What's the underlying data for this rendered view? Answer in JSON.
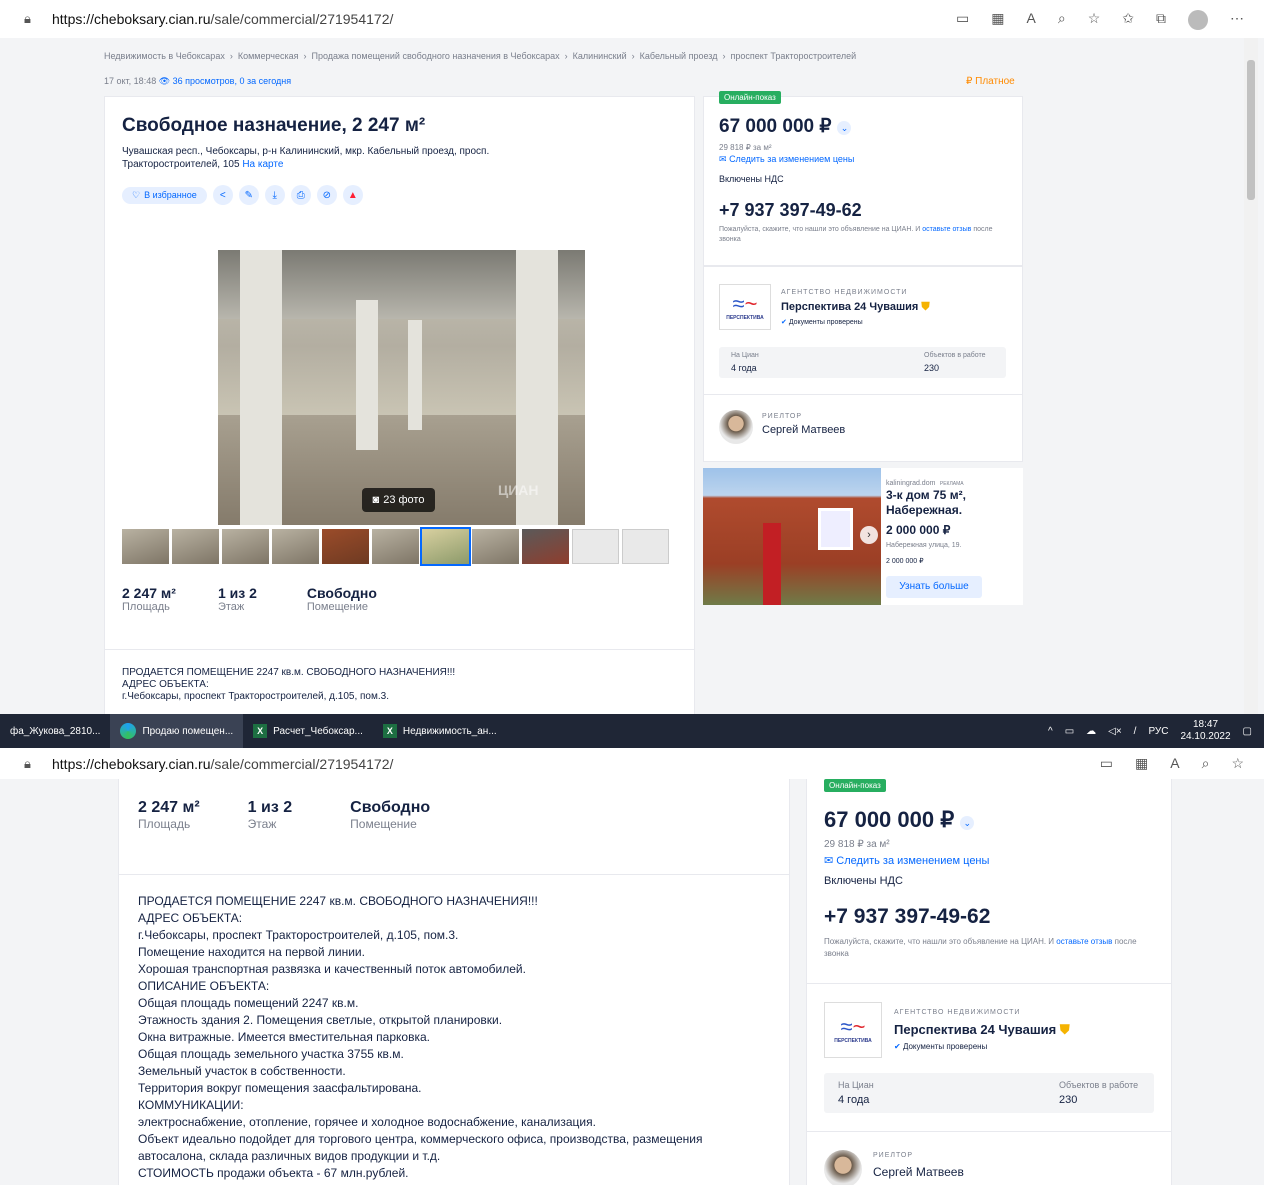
{
  "browser": {
    "url_host": "https://cheboksary.cian.ru",
    "url_path": "/sale/commercial/271954172/",
    "lock_icon": "lock-icon"
  },
  "breadcrumbs": [
    "Недвижимость в Чебоксарах",
    "Коммерческая",
    "Продажа помещений свободного назначения в Чебоксарах",
    "Калининский",
    "Кабельный проезд",
    "проспект Тракторостроителей"
  ],
  "breadcrumb_sep": "›",
  "meta": {
    "date": "17 окт, 18:48",
    "views": "36 просмотров, 0 за сегодня",
    "paid": "₽ Платное"
  },
  "listing": {
    "title": "Свободное назначение, 2 247 м²",
    "address": "Чувашская респ., Чебоксары, р-н Калининский, мкр. Кабельный проезд, просп. Тракторостроителей, 105",
    "map_link": "На карте",
    "fav": "В избранное",
    "photos_count": "23 фото",
    "watermark": "ЦИАН",
    "stats": [
      {
        "value": "2 247 м²",
        "label": "Площадь"
      },
      {
        "value": "1 из 2",
        "label": "Этаж"
      },
      {
        "value": "Свободно",
        "label": "Помещение"
      }
    ]
  },
  "description": [
    "ПРОДАЕТСЯ ПОМЕЩЕНИЕ 2247 кв.м. СВОБОДНОГО НАЗНАЧЕНИЯ!!!",
    "АДРЕС ОБЪЕКТА:",
    "г.Чебоксары, проспект Тракторостроителей, д.105, пом.3.",
    "Помещение находится на первой линии.",
    "Хорошая транспортная развязка и качественный поток автомобилей.",
    "ОПИСАНИЕ ОБЪЕКТА:",
    "Общая площадь помещений 2247 кв.м.",
    "Этажность здания 2. Помещения светлые, открытой планировки.",
    "Окна витражные. Имеется вместительная парковка.",
    "Общая площадь земельного участка 3755 кв.м.",
    "Земельный участок в собственности.",
    "Территория вокруг помещения заасфальтирована.",
    "КОММУНИКАЦИИ:",
    "электроснабжение, отопление, горячее и холодное водоснабжение, канализация.",
    "Объект идеально подойдет для торгового центра, коммерческого офиса, производства, размещения",
    "автосалона, склада различных видов продукции и т.д.",
    "СТОИМОСТЬ продажи объекта - 67 млн.рублей."
  ],
  "sidebar": {
    "online": "Онлайн-показ",
    "price": "67 000 000 ₽",
    "per_m2": "29 818 ₽ за м²",
    "track": "Следить за изменением цены",
    "nds": "Включены НДС",
    "phone": "+7 937 397-49-62",
    "note_a": "Пожалуйста, скажите, что нашли это объявление на ЦИАН. И",
    "note_link": "оставьте отзыв",
    "note_b": "после звонка",
    "agency_type": "АГЕНТСТВО НЕДВИЖИМОСТИ",
    "agency_name": "Перспектива 24 Чувашия",
    "agency_verified": "Документы проверены",
    "logo_text": "ПЕРСПЕКТИВА",
    "on_cian_label": "На Циан",
    "on_cian_value": "4 года",
    "objects_label": "Объектов в работе",
    "objects_value": "230",
    "realtor_type": "РИЕЛТОР",
    "realtor_name": "Сергей Матвеев"
  },
  "ad": {
    "source": "kaliningrad.dom",
    "tag": "РЕКЛАМА",
    "title": "3-к дом 75 м², Набережная.",
    "price": "2 000 000 ₽",
    "address": "Набережная улица, 19.",
    "price2": "2 000 000 ₽",
    "button": "Узнать больше"
  },
  "taskbar": {
    "items": [
      "фа_Жукова_2810...",
      "Продаю помещен...",
      "Расчет_Чебоксар...",
      "Недвижимость_ан..."
    ],
    "lang": "РУС",
    "time": "18:47",
    "date": "24.10.2022"
  }
}
